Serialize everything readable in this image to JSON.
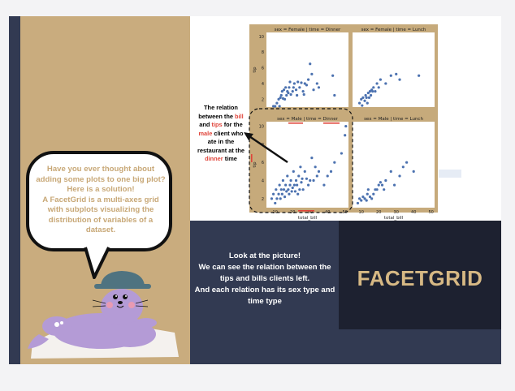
{
  "speech_bubble": {
    "lines": [
      "Have you ever thought about",
      "adding some plots to one big plot?",
      "Here is a solution!",
      "A FacetGrid is a multi-axes grid",
      "with subplots visualizing the",
      "distribution of variables of a",
      "dataset."
    ]
  },
  "annotation": {
    "line1": "The relation",
    "line2_a": "between the ",
    "line2_bill": "bill",
    "line3_a": "and ",
    "line3_tips": "tips",
    "line3_b": " for the",
    "line4_male": "male",
    "line4_b": " client who",
    "line5": "ate in the",
    "line6": "restaurant at the",
    "line7_dinner": "dinner",
    "line7_b": " time"
  },
  "bottom_text": {
    "lines": [
      "Look at the picture!",
      "We can see the relation between the",
      "tips and bills clients left.",
      "And each relation has its sex type and",
      "time type"
    ]
  },
  "title": "FACETGRID",
  "colors": {
    "navy": "#323a52",
    "tan": "#c9ac7e",
    "dark_box": "#1d2130",
    "gold": "#d6b884",
    "accent_red": "#e0453b",
    "point": "#4c72b0",
    "seal": "#b49bd6",
    "hat": "#4f7380"
  },
  "chart_data": {
    "type": "scatter",
    "facet_titles": [
      "sex = Female | time = Dinner",
      "sex = Female | time = Lunch",
      "sex = Male | time = Dinner",
      "sex = Male | time = Lunch"
    ],
    "xlabel": "total_bill",
    "ylabel": "tip",
    "x_ticks": [
      "10",
      "20",
      "30",
      "40",
      "50"
    ],
    "y_ticks": [
      "2",
      "4",
      "6",
      "8",
      "10"
    ],
    "xlim": [
      5,
      52
    ],
    "ylim": [
      1,
      10.5
    ],
    "panels": [
      {
        "name": "sex = Female | time = Dinner",
        "x": [
          9,
          10,
          11,
          12,
          12.5,
          13,
          13.5,
          14,
          14.5,
          15,
          15.5,
          16,
          16.5,
          17,
          17.5,
          18,
          18.5,
          19,
          20,
          20.5,
          21,
          22,
          22.5,
          23,
          24,
          25,
          26,
          26.5,
          27,
          28,
          29,
          30,
          31,
          32,
          34,
          35,
          43,
          44
        ],
        "y": [
          1.1,
          1.1,
          1.5,
          2,
          1.1,
          2.2,
          2.5,
          3,
          2.1,
          3.2,
          2,
          3.5,
          2.5,
          3,
          2.8,
          3.5,
          4.2,
          2.6,
          3,
          3.5,
          4,
          3.2,
          2.5,
          4.2,
          3.5,
          4.1,
          3,
          2.6,
          4,
          3.8,
          4.5,
          6.5,
          5.2,
          3.2,
          4,
          3.5,
          5,
          2.5
        ]
      },
      {
        "name": "sex = Female | time = Lunch",
        "x": [
          9,
          10,
          10.5,
          11,
          12,
          12.5,
          13,
          13.5,
          14,
          14.5,
          15,
          15.5,
          16,
          16.5,
          17,
          18,
          19,
          20,
          21,
          24,
          27,
          30,
          32,
          43
        ],
        "y": [
          1.5,
          2,
          1.2,
          2.2,
          1.8,
          2.5,
          2.2,
          1.5,
          2.8,
          2.2,
          3,
          2.5,
          3.2,
          3,
          3.5,
          3,
          4,
          3.5,
          4.5,
          4,
          5,
          5.2,
          4.5,
          5
        ]
      },
      {
        "name": "sex = Male | time = Dinner",
        "x": [
          8,
          9,
          10,
          10.5,
          11,
          12,
          12.5,
          13,
          13.5,
          14,
          14.5,
          15,
          15.5,
          16,
          16.5,
          17,
          17.5,
          18,
          18.5,
          19,
          19.5,
          20,
          20.5,
          21,
          21.5,
          22,
          22.5,
          23,
          23.5,
          24,
          24.5,
          25,
          25.5,
          26,
          27,
          28,
          29,
          30,
          31,
          32,
          33,
          34,
          35,
          38,
          40,
          42,
          44,
          48,
          50,
          50.5
        ],
        "y": [
          2,
          2.5,
          1.5,
          3,
          2,
          2.5,
          3.5,
          2,
          3,
          2.5,
          4,
          3,
          2.2,
          3.5,
          2.8,
          4.5,
          3,
          2.5,
          3.5,
          4,
          2.8,
          3.2,
          5,
          3.5,
          2.8,
          4,
          3.5,
          2.5,
          4.5,
          3,
          5.5,
          3.8,
          4.2,
          3,
          5,
          4.2,
          3.5,
          4,
          6.5,
          4,
          5.5,
          4.5,
          5,
          3.5,
          4.5,
          5,
          6,
          7,
          9,
          10
        ]
      },
      {
        "name": "sex = Male | time = Lunch",
        "x": [
          8,
          9,
          10,
          11,
          12,
          13,
          13.5,
          14,
          15,
          16,
          17,
          18,
          19,
          20,
          21,
          22,
          23,
          24,
          27,
          29,
          32,
          34,
          36,
          40
        ],
        "y": [
          1.5,
          2,
          1.8,
          2.2,
          2,
          1.8,
          2.5,
          3,
          2.2,
          2,
          2.5,
          3,
          3,
          3.5,
          3.8,
          3.5,
          3,
          4,
          5,
          3.5,
          4.5,
          5.5,
          6,
          5
        ]
      }
    ]
  }
}
